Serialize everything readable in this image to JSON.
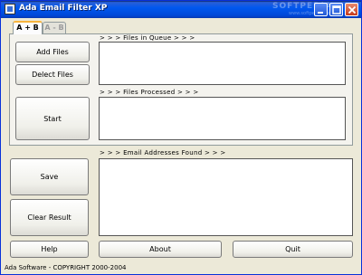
{
  "window": {
    "title": "Ada Email Filter XP",
    "watermark": "SOFTPEDIA",
    "watermark_sub": "www.softpedia.com"
  },
  "tabs": [
    {
      "label": "A + B",
      "active": true
    },
    {
      "label": "A - B",
      "active": false
    }
  ],
  "buttons": {
    "add_files": "Add Files",
    "delect_files": "Delect Files",
    "start": "Start",
    "save": "Save",
    "clear_result": "Clear Result",
    "help": "Help",
    "about": "About",
    "quit": "Quit"
  },
  "sections": {
    "files_in_queue": "> > > Files in Queue > > >",
    "files_processed": "> > > Files Processed > > >",
    "email_addresses_found": "> > > Email Addresses Found > > >"
  },
  "status": "Ada Software - COPYRIGHT 2000-2004",
  "colors": {
    "titlebar": "#0058ee",
    "window_bg": "#ece9d8",
    "active_tab_accent": "#f8b43c"
  }
}
